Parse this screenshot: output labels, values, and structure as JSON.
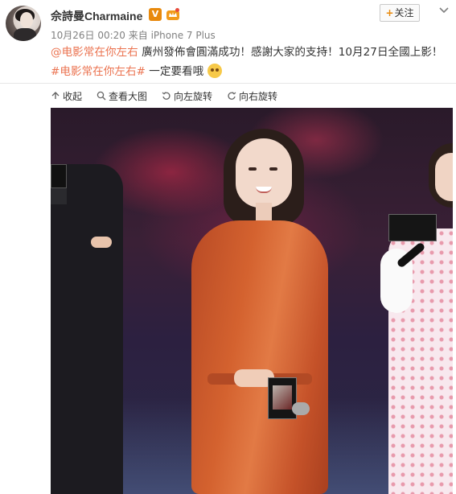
{
  "post": {
    "username": "佘詩曼Charmaine",
    "verified_badge": "V",
    "follow_button": {
      "plus": "+",
      "label": "关注"
    },
    "meta": "10月26日 00:20 来自 iPhone 7 Plus",
    "text": {
      "mention": "@电影常在你左右",
      "line1": " 廣州發佈會圓滿成功！感謝大家的支持！10月27日全國上影！",
      "hashtag": "#电影常在你左右#",
      "line2": " 一定要看哦"
    }
  },
  "toolbar": {
    "collapse": "收起",
    "view_large": "查看大图",
    "rotate_left": "向左旋转",
    "rotate_right": "向右旋转"
  },
  "icons": {
    "verified": "verified-v-icon",
    "member": "crown-icon",
    "more": "chevron-down-icon",
    "emoji": "smiley-emoji-icon"
  },
  "colors": {
    "accent_orange": "#e8890c",
    "link": "#eb7350",
    "meta_gray": "#808080"
  }
}
